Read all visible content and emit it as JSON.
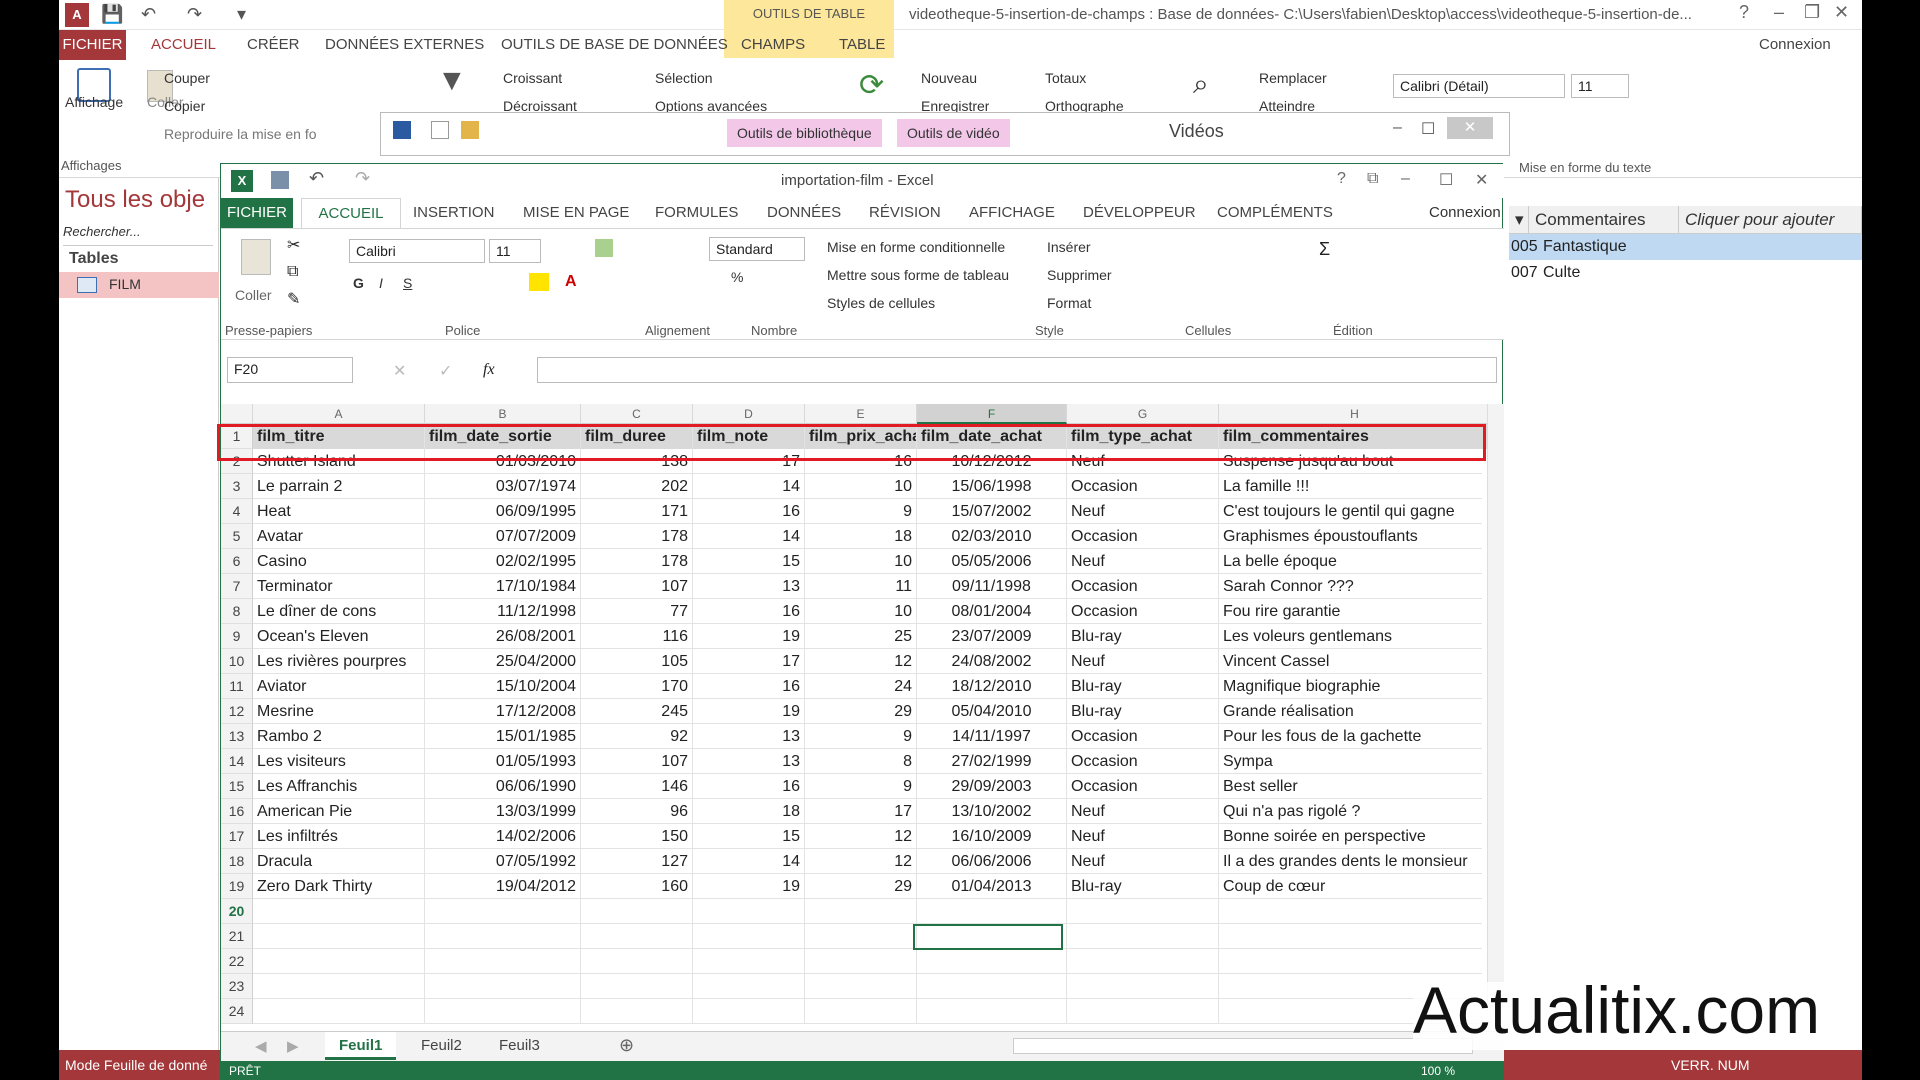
{
  "access": {
    "qat": {
      "save": "💾",
      "undo": "↶",
      "redo": "↷",
      "more": "▾"
    },
    "context_tab_group": "OUTILS DE TABLE",
    "window_title": "videotheque-5-insertion-de-champs : Base de données- C:\\Users\\fabien\\Desktop\\access\\videotheque-5-insertion-de...",
    "tabs": [
      "ACCUEIL",
      "CRÉER",
      "DONNÉES EXTERNES",
      "OUTILS DE BASE DE DONNÉES",
      "CHAMPS",
      "TABLE"
    ],
    "file_tab": "FICHIER",
    "connexion": "Connexion",
    "ribbon": {
      "affichage": "Affichage",
      "coller": "Coller",
      "couper": "Couper",
      "copier": "Copier",
      "reproduire": "Reproduire la mise en fo",
      "croissant": "Croissant",
      "decroissant": "Décroissant",
      "selection": "Sélection",
      "options": "Options avancées",
      "nouveau": "Nouveau",
      "enregistrer": "Enregistrer",
      "totaux": "Totaux",
      "orthographe": "Orthographe",
      "remplacer": "Remplacer",
      "atteindre": "Atteindre",
      "font": "Calibri (Détail)",
      "size": "11",
      "group_affichages": "Affichages",
      "group_mef": "Mise en forme du texte"
    },
    "nav": {
      "title": "Tous les obje",
      "search": "Rechercher...",
      "tables": "Tables",
      "film": "FILM"
    },
    "status_left": "Mode Feuille de donné",
    "status_right": "VERR. NUM",
    "datasheet": {
      "col1": "Commentaires",
      "col2": "Cliquer pour ajouter",
      "rows": [
        {
          "id": "005",
          "text": "Fantastique"
        },
        {
          "id": "007",
          "text": "Culte"
        }
      ]
    }
  },
  "video": {
    "title": "Vidéos",
    "tab1": "Outils de bibliothèque",
    "tab2": "Outils de vidéo"
  },
  "excel": {
    "title": "importation-film - Excel",
    "file_tab": "FICHIER",
    "tabs": [
      "ACCUEIL",
      "INSERTION",
      "MISE EN PAGE",
      "FORMULES",
      "DONNÉES",
      "RÉVISION",
      "AFFICHAGE",
      "DÉVELOPPEUR",
      "COMPLÉMENTS"
    ],
    "connexion": "Connexion",
    "ribbon": {
      "coller": "Coller",
      "font": "Calibri",
      "size": "11",
      "bold": "G",
      "italic": "I",
      "underline": "S",
      "number_format": "Standard",
      "mfc": "Mise en forme conditionnelle",
      "table": "Mettre sous forme de tableau",
      "styles": "Styles de cellules",
      "inserer": "Insérer",
      "supprimer": "Supprimer",
      "format": "Format",
      "groups": {
        "presse": "Presse-papiers",
        "police": "Police",
        "alignement": "Alignement",
        "nombre": "Nombre",
        "style": "Style",
        "cellules": "Cellules",
        "edition": "Édition"
      }
    },
    "name_box": "F20",
    "fx": "fx",
    "col_letters": [
      "A",
      "B",
      "C",
      "D",
      "E",
      "F",
      "G",
      "H"
    ],
    "headers": [
      "film_titre",
      "film_date_sortie",
      "film_duree",
      "film_note",
      "film_prix_achat",
      "film_date_achat",
      "film_type_achat",
      "film_commentaires"
    ],
    "rows": [
      [
        "Shutter Island",
        "01/03/2010",
        "138",
        "17",
        "16",
        "10/12/2012",
        "Neuf",
        "Suspense jusqu'au bout"
      ],
      [
        "Le parrain 2",
        "03/07/1974",
        "202",
        "14",
        "10",
        "15/06/1998",
        "Occasion",
        "La famille !!!"
      ],
      [
        "Heat",
        "06/09/1995",
        "171",
        "16",
        "9",
        "15/07/2002",
        "Neuf",
        "C'est toujours le gentil qui gagne"
      ],
      [
        "Avatar",
        "07/07/2009",
        "178",
        "14",
        "18",
        "02/03/2010",
        "Occasion",
        "Graphismes époustouflants"
      ],
      [
        "Casino",
        "02/02/1995",
        "178",
        "15",
        "10",
        "05/05/2006",
        "Neuf",
        "La belle époque"
      ],
      [
        "Terminator",
        "17/10/1984",
        "107",
        "13",
        "11",
        "09/11/1998",
        "Occasion",
        "Sarah Connor ???"
      ],
      [
        "Le dîner de cons",
        "11/12/1998",
        "77",
        "16",
        "10",
        "08/01/2004",
        "Occasion",
        "Fou rire garantie"
      ],
      [
        "Ocean's Eleven",
        "26/08/2001",
        "116",
        "19",
        "25",
        "23/07/2009",
        "Blu-ray",
        "Les voleurs gentlemans"
      ],
      [
        "Les rivières pourpres",
        "25/04/2000",
        "105",
        "17",
        "12",
        "24/08/2002",
        "Neuf",
        "Vincent Cassel"
      ],
      [
        "Aviator",
        "15/10/2004",
        "170",
        "16",
        "24",
        "18/12/2010",
        "Blu-ray",
        "Magnifique biographie"
      ],
      [
        "Mesrine",
        "17/12/2008",
        "245",
        "19",
        "29",
        "05/04/2010",
        "Blu-ray",
        "Grande réalisation"
      ],
      [
        "Rambo 2",
        "15/01/1985",
        "92",
        "13",
        "9",
        "14/11/1997",
        "Occasion",
        "Pour les fous de la gachette"
      ],
      [
        "Les visiteurs",
        "01/05/1993",
        "107",
        "13",
        "8",
        "27/02/1999",
        "Occasion",
        "Sympa"
      ],
      [
        "Les Affranchis",
        "06/06/1990",
        "146",
        "16",
        "9",
        "29/09/2003",
        "Occasion",
        "Best seller"
      ],
      [
        "American Pie",
        "13/03/1999",
        "96",
        "18",
        "17",
        "13/10/2002",
        "Neuf",
        "Qui n'a pas rigolé ?"
      ],
      [
        "Les infiltrés",
        "14/02/2006",
        "150",
        "15",
        "12",
        "16/10/2009",
        "Neuf",
        "Bonne soirée en perspective"
      ],
      [
        "Dracula",
        "07/05/1992",
        "127",
        "14",
        "12",
        "06/06/2006",
        "Neuf",
        "Il a des grandes dents le monsieur"
      ],
      [
        "Zero Dark Thirty",
        "19/04/2012",
        "160",
        "19",
        "29",
        "01/04/2013",
        "Blu-ray",
        "Coup de cœur"
      ]
    ],
    "empty_rows": [
      "20",
      "21",
      "22",
      "23",
      "24"
    ],
    "sheets": [
      "Feuil1",
      "Feuil2",
      "Feuil3"
    ],
    "status": "PRÊT",
    "zoom": "100 %"
  },
  "watermark": "Actualitix.com"
}
